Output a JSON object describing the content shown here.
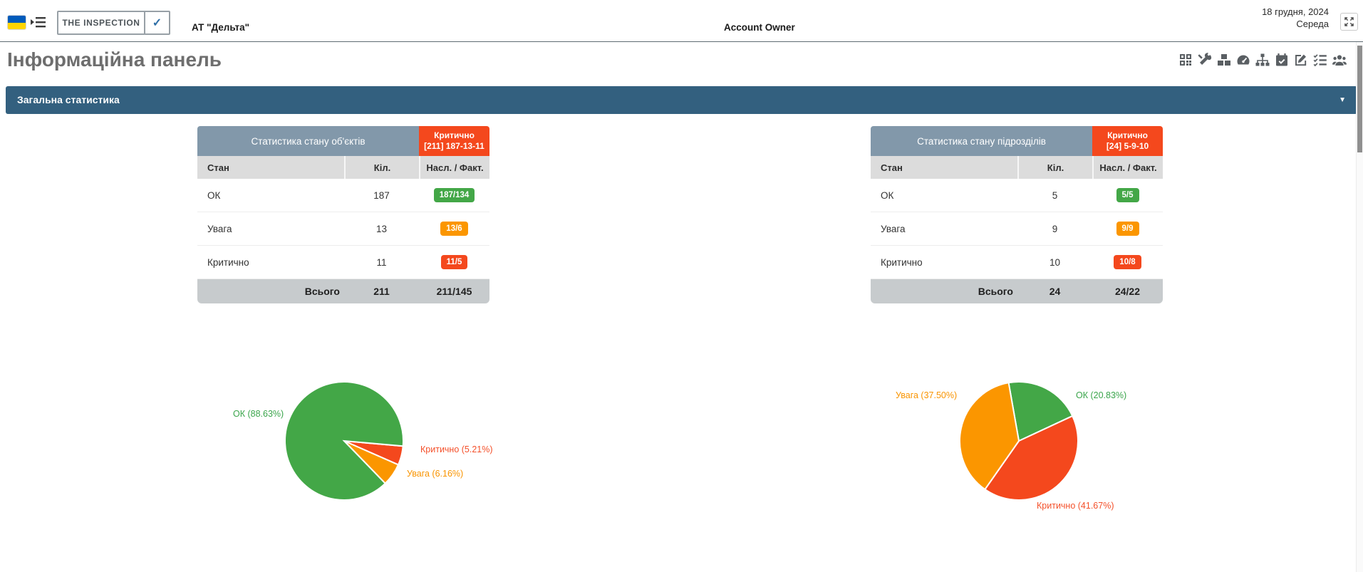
{
  "topbar": {
    "logo_text": "THE INSPECTION",
    "logo_check": "✓",
    "company": "АТ \"Дельта\"",
    "account_owner": "Account Owner",
    "date_line1": "18 грудня, 2024",
    "date_line2": "Середа"
  },
  "page": {
    "title": "Інформаційна панель"
  },
  "toolbar_icons": [
    "qrcode-icon",
    "tools-icon",
    "cubes-icon",
    "tachometer-icon",
    "sitemap-icon",
    "calendar-check-icon",
    "edit-icon",
    "tasks-icon",
    "users-icon"
  ],
  "panel": {
    "title": "Загальна статистика",
    "caret": "▼"
  },
  "tables": [
    {
      "title": "Статистика стану об'єктів",
      "critical_badge": {
        "line1": "Критично",
        "line2": "[211] 187-13-11"
      },
      "columns": [
        "Стан",
        "Кіл.",
        "Насл. / Факт."
      ],
      "rows": [
        {
          "label": "ОК",
          "count": "187",
          "ratio": "187/134",
          "status": "ok"
        },
        {
          "label": "Увага",
          "count": "13",
          "ratio": "13/6",
          "status": "warn"
        },
        {
          "label": "Критично",
          "count": "11",
          "ratio": "11/5",
          "status": "crit"
        }
      ],
      "footer": {
        "label": "Всього",
        "count": "211",
        "ratio": "211/145"
      }
    },
    {
      "title": "Статистика стану підрозділів",
      "critical_badge": {
        "line1": "Критично",
        "line2": "[24] 5-9-10"
      },
      "columns": [
        "Стан",
        "Кіл.",
        "Насл. / Факт."
      ],
      "rows": [
        {
          "label": "ОК",
          "count": "5",
          "ratio": "5/5",
          "status": "ok"
        },
        {
          "label": "Увага",
          "count": "9",
          "ratio": "9/9",
          "status": "warn"
        },
        {
          "label": "Критично",
          "count": "10",
          "ratio": "10/8",
          "status": "crit"
        }
      ],
      "footer": {
        "label": "Всього",
        "count": "24",
        "ratio": "24/22"
      }
    }
  ],
  "chart_data": [
    {
      "type": "pie",
      "title": "Статистика стану об'єктів",
      "total": 211,
      "start_angle": 95,
      "legend": "none",
      "labels": "outside",
      "slices": [
        {
          "label": "Критично",
          "value": 11,
          "pct": 5.21,
          "color": "#f4481d",
          "text": "Критично (5.21%)"
        },
        {
          "label": "Увага",
          "value": 13,
          "pct": 6.16,
          "color": "#fb9600",
          "text": "Увага (6.16%)"
        },
        {
          "label": "ОК",
          "value": 187,
          "pct": 88.63,
          "color": "#43a747",
          "text": "ОК (88.63%)"
        }
      ]
    },
    {
      "type": "pie",
      "title": "Статистика стану підрозділів",
      "total": 24,
      "start_angle": 350,
      "legend": "none",
      "labels": "outside",
      "slices": [
        {
          "label": "ОК",
          "value": 5,
          "pct": 20.83,
          "color": "#43a747",
          "text": "ОК (20.83%)"
        },
        {
          "label": "Критично",
          "value": 10,
          "pct": 41.67,
          "color": "#f4481d",
          "text": "Критично (41.67%)"
        },
        {
          "label": "Увага",
          "value": 9,
          "pct": 37.5,
          "color": "#fb9600",
          "text": "Увага (37.50%)"
        }
      ]
    }
  ],
  "colors": {
    "panel_bar": "#33607f",
    "table_header": "#8298aa",
    "critical": "#f4481d",
    "warning": "#fb9600",
    "ok": "#43a747",
    "col_header_bg": "#dcdcdc",
    "footer_bg": "#c7cbcd"
  }
}
